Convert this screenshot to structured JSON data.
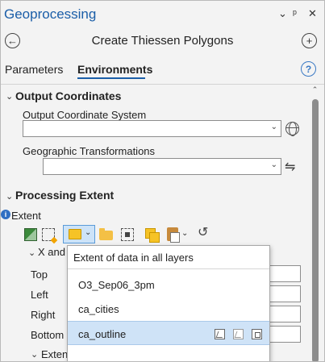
{
  "pane": {
    "title": "Geoprocessing",
    "controls": [
      "⌄",
      "ᵖ",
      "✕"
    ],
    "tool_name": "Create Thiessen Polygons"
  },
  "tabs": [
    {
      "label": "Parameters",
      "active": false
    },
    {
      "label": "Environments",
      "active": true
    }
  ],
  "help_icon": "question-icon",
  "output_coordinates": {
    "section_label": "Output Coordinates",
    "ocs_label": "Output Coordinate System",
    "ocs_value": "",
    "geo_label": "Geographic Transformations",
    "geo_value": ""
  },
  "processing_extent": {
    "section_label": "Processing Extent",
    "extent_label": "Extent",
    "sub_label": "X and",
    "fields": [
      {
        "label": "Top",
        "value": ""
      },
      {
        "label": "Left",
        "value": ""
      },
      {
        "label": "Right",
        "value": ""
      },
      {
        "label": "Bottom",
        "value": ""
      }
    ],
    "coord_sys_label": "Extent Coordinate System"
  },
  "extent_popup": {
    "header": "Extent of data in all layers",
    "items": [
      {
        "label": "O3_Sep06_3pm",
        "selected": false
      },
      {
        "label": "ca_cities",
        "selected": false
      },
      {
        "label": "ca_outline",
        "selected": true
      }
    ]
  },
  "colors": {
    "accent": "#1b5ea8",
    "selection": "#cfe3f7",
    "info": "#2f6fc3"
  }
}
